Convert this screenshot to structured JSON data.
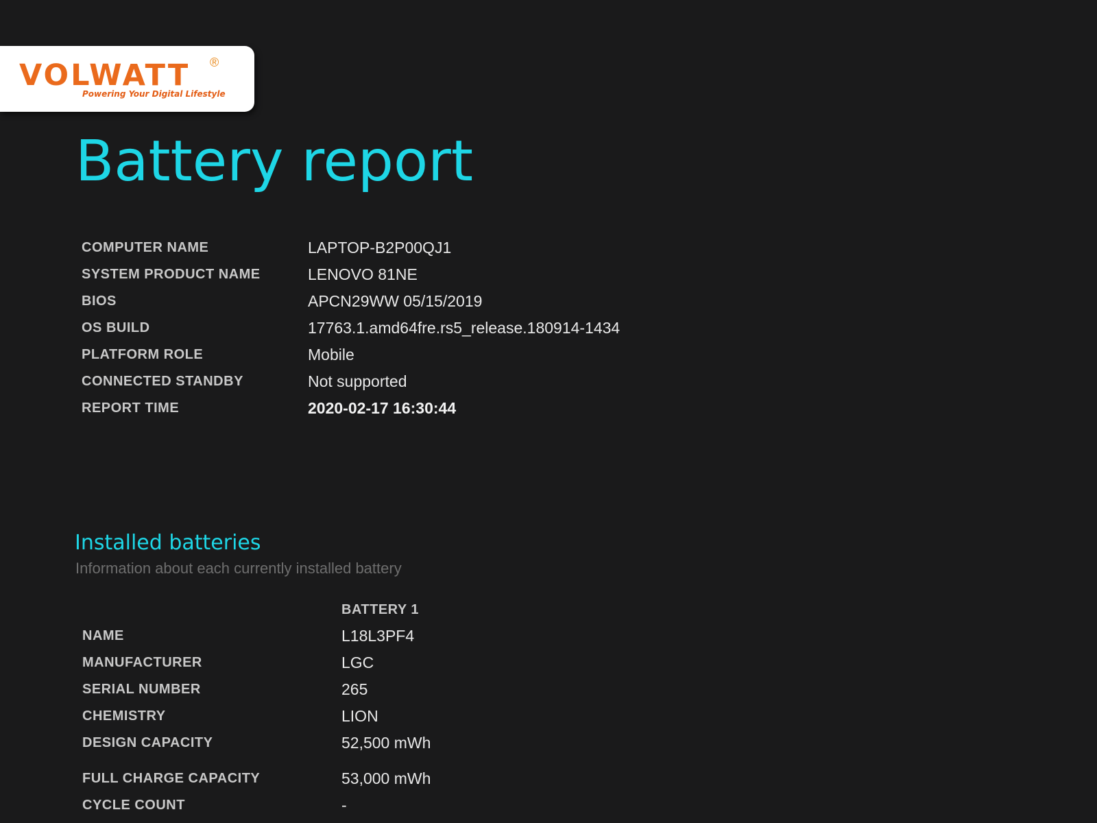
{
  "logo": {
    "brand": "VOLWATT",
    "registered": "®",
    "tagline": "Powering Your Digital Lifestyle"
  },
  "title": "Battery report",
  "system_info": [
    {
      "label": "COMPUTER NAME",
      "value": "LAPTOP-B2P00QJ1"
    },
    {
      "label": "SYSTEM PRODUCT NAME",
      "value": "LENOVO 81NE"
    },
    {
      "label": "BIOS",
      "value": "APCN29WW 05/15/2019"
    },
    {
      "label": "OS BUILD",
      "value": "17763.1.amd64fre.rs5_release.180914-1434"
    },
    {
      "label": "PLATFORM ROLE",
      "value": "Mobile"
    },
    {
      "label": "CONNECTED STANDBY",
      "value": "Not supported"
    },
    {
      "label": "REPORT TIME",
      "value": "2020-02-17  16:30:44"
    }
  ],
  "installed_batteries": {
    "title": "Installed batteries",
    "subtitle": "Information about each currently installed battery",
    "column_header": "BATTERY 1",
    "rows": [
      {
        "label": "NAME",
        "value": "L18L3PF4"
      },
      {
        "label": "MANUFACTURER",
        "value": "LGC"
      },
      {
        "label": "SERIAL NUMBER",
        "value": "265"
      },
      {
        "label": "CHEMISTRY",
        "value": "LION"
      },
      {
        "label": "DESIGN CAPACITY",
        "value": "52,500 mWh"
      },
      {
        "label": "FULL CHARGE CAPACITY",
        "value": "53,000 mWh"
      },
      {
        "label": "CYCLE COUNT",
        "value": "-"
      }
    ]
  },
  "colors": {
    "background": "#1a1a1b",
    "accent": "#1ed6e6",
    "brand_orange": "#ea6a1c"
  }
}
